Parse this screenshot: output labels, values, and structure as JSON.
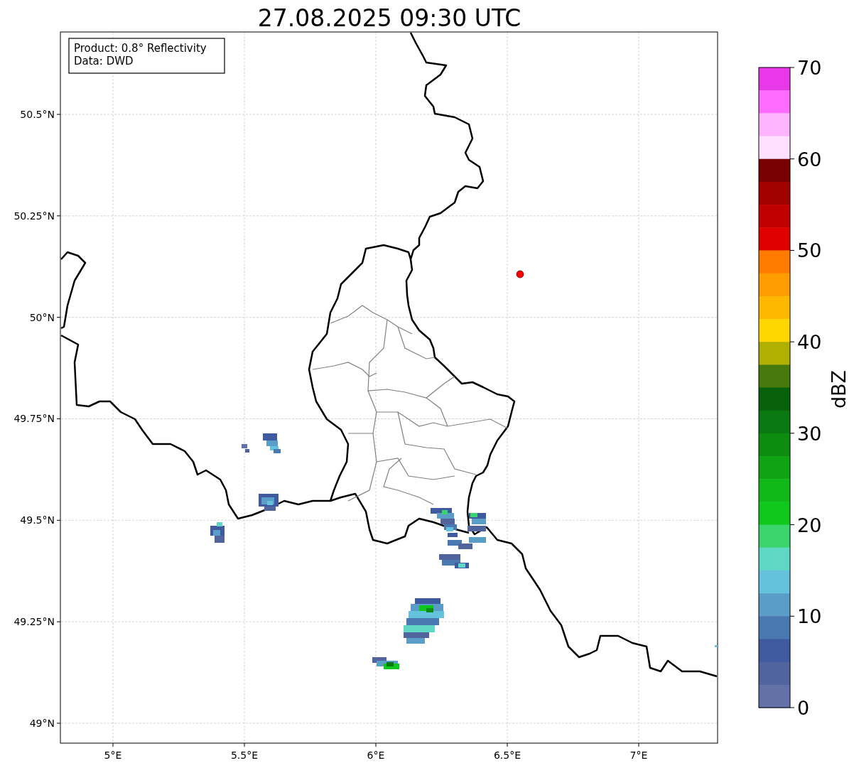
{
  "title": "27.08.2025 09:30 UTC",
  "info_box": {
    "lines": [
      "Product: 0.8° Reflectivity",
      "Data: DWD"
    ]
  },
  "map": {
    "lat_ticks": [
      "50.5°N",
      "50.25°N",
      "50°N",
      "49.75°N",
      "49.5°N",
      "49.25°N",
      "49°N"
    ],
    "lon_ticks": [
      "5°E",
      "5.5°E",
      "6°E",
      "6.5°E",
      "7°E"
    ]
  },
  "colorbar": {
    "ticks": [
      "70",
      "60",
      "50",
      "40",
      "30",
      "20",
      "10",
      "0"
    ],
    "label": "dBZ",
    "bins": [
      {
        "color": "#e838e8"
      },
      {
        "color": "#ff6cff"
      },
      {
        "color": "#ffb4ff"
      },
      {
        "color": "#ffe0ff"
      },
      {
        "color": "#780000"
      },
      {
        "color": "#a00000"
      },
      {
        "color": "#c00000"
      },
      {
        "color": "#e00000"
      },
      {
        "color": "#ff7c00"
      },
      {
        "color": "#ff9c00"
      },
      {
        "color": "#ffb800"
      },
      {
        "color": "#ffd600"
      },
      {
        "color": "#b0b000"
      },
      {
        "color": "#467a0c"
      },
      {
        "color": "#06600c"
      },
      {
        "color": "#0a7810"
      },
      {
        "color": "#0e8c10"
      },
      {
        "color": "#10a414"
      },
      {
        "color": "#10b818"
      },
      {
        "color": "#10c81c"
      },
      {
        "color": "#3cd46c"
      },
      {
        "color": "#5ed8c4"
      },
      {
        "color": "#64c2dc"
      },
      {
        "color": "#5a9ec8"
      },
      {
        "color": "#4a78b0"
      },
      {
        "color": "#405aa0"
      },
      {
        "color": "#52649e"
      },
      {
        "color": "#6272a8"
      }
    ]
  }
}
